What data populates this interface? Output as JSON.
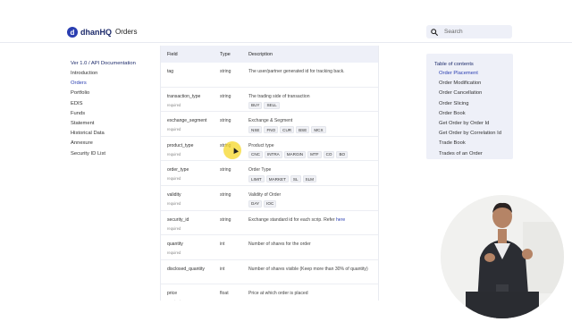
{
  "header": {
    "logo_mark": "d",
    "logo_text": "dhanHQ",
    "nav_orders": "Orders",
    "search_placeholder": "Search"
  },
  "sidebar": {
    "version": "Ver 1.0 / API Documentation",
    "items": [
      {
        "label": "Introduction",
        "active": false
      },
      {
        "label": "Orders",
        "active": true
      },
      {
        "label": "Portfolio",
        "active": false
      },
      {
        "label": "EDIS",
        "active": false
      },
      {
        "label": "Funds",
        "active": false
      },
      {
        "label": "Statement",
        "active": false
      },
      {
        "label": "Historical Data",
        "active": false
      },
      {
        "label": "Annexure",
        "active": false
      },
      {
        "label": "Security ID List",
        "active": false
      }
    ]
  },
  "table": {
    "headers": {
      "field": "Field",
      "type": "Type",
      "description": "Description"
    },
    "required_label": "required",
    "rows": [
      {
        "field": "tag",
        "required": false,
        "type": "string",
        "description": "The user/partner generated id for tracking back.",
        "chips": []
      },
      {
        "field": "transaction_type",
        "required": true,
        "type": "string",
        "description": "The trading side of transaction",
        "chips": [
          "BUY",
          "SELL"
        ]
      },
      {
        "field": "exchange_segment",
        "required": true,
        "type": "string",
        "description": "Exchange & Segment",
        "chips": [
          "NSE",
          "FNO",
          "CUR",
          "BSE",
          "MCX"
        ]
      },
      {
        "field": "product_type",
        "required": true,
        "type": "string",
        "description": "Product type",
        "chips": [
          "CNC",
          "INTRA",
          "MARGIN",
          "MTF",
          "CO",
          "BO"
        ]
      },
      {
        "field": "order_type",
        "required": true,
        "type": "string",
        "description": "Order Type",
        "chips": [
          "LIMIT",
          "MARKET",
          "SL",
          "SLM"
        ]
      },
      {
        "field": "validity",
        "required": true,
        "type": "string",
        "description": "Validity of Order",
        "chips": [
          "DAY",
          "IOC"
        ]
      },
      {
        "field": "security_id",
        "required": true,
        "type": "string",
        "description": "Exchange standard id for each scrip. Refer ",
        "link": "here",
        "chips": []
      },
      {
        "field": "quantity",
        "required": true,
        "type": "int",
        "description": "Number of shares for the order",
        "chips": []
      },
      {
        "field": "disclosed_quantity",
        "required": false,
        "type": "int",
        "description": "Number of shares visible (Keep more than 30% of quantity)",
        "chips": []
      },
      {
        "field": "price",
        "required": true,
        "type": "float",
        "description": "Price at which order is placed",
        "chips": []
      }
    ]
  },
  "toc": {
    "title": "Table of contents",
    "items": [
      {
        "label": "Order Placement",
        "active": true
      },
      {
        "label": "Order Modification",
        "active": false
      },
      {
        "label": "Order Cancellation",
        "active": false
      },
      {
        "label": "Order Slicing",
        "active": false
      },
      {
        "label": "Order Book",
        "active": false
      },
      {
        "label": "Get Order by Order Id",
        "active": false
      },
      {
        "label": "Get Order by Correlation Id",
        "active": false
      },
      {
        "label": "Trade Book",
        "active": false
      },
      {
        "label": "Trades of an Order",
        "active": false
      }
    ]
  },
  "colors": {
    "brand": "#2a3eb1",
    "highlight": "#f5d728",
    "panel_bg": "#eef0f8"
  }
}
